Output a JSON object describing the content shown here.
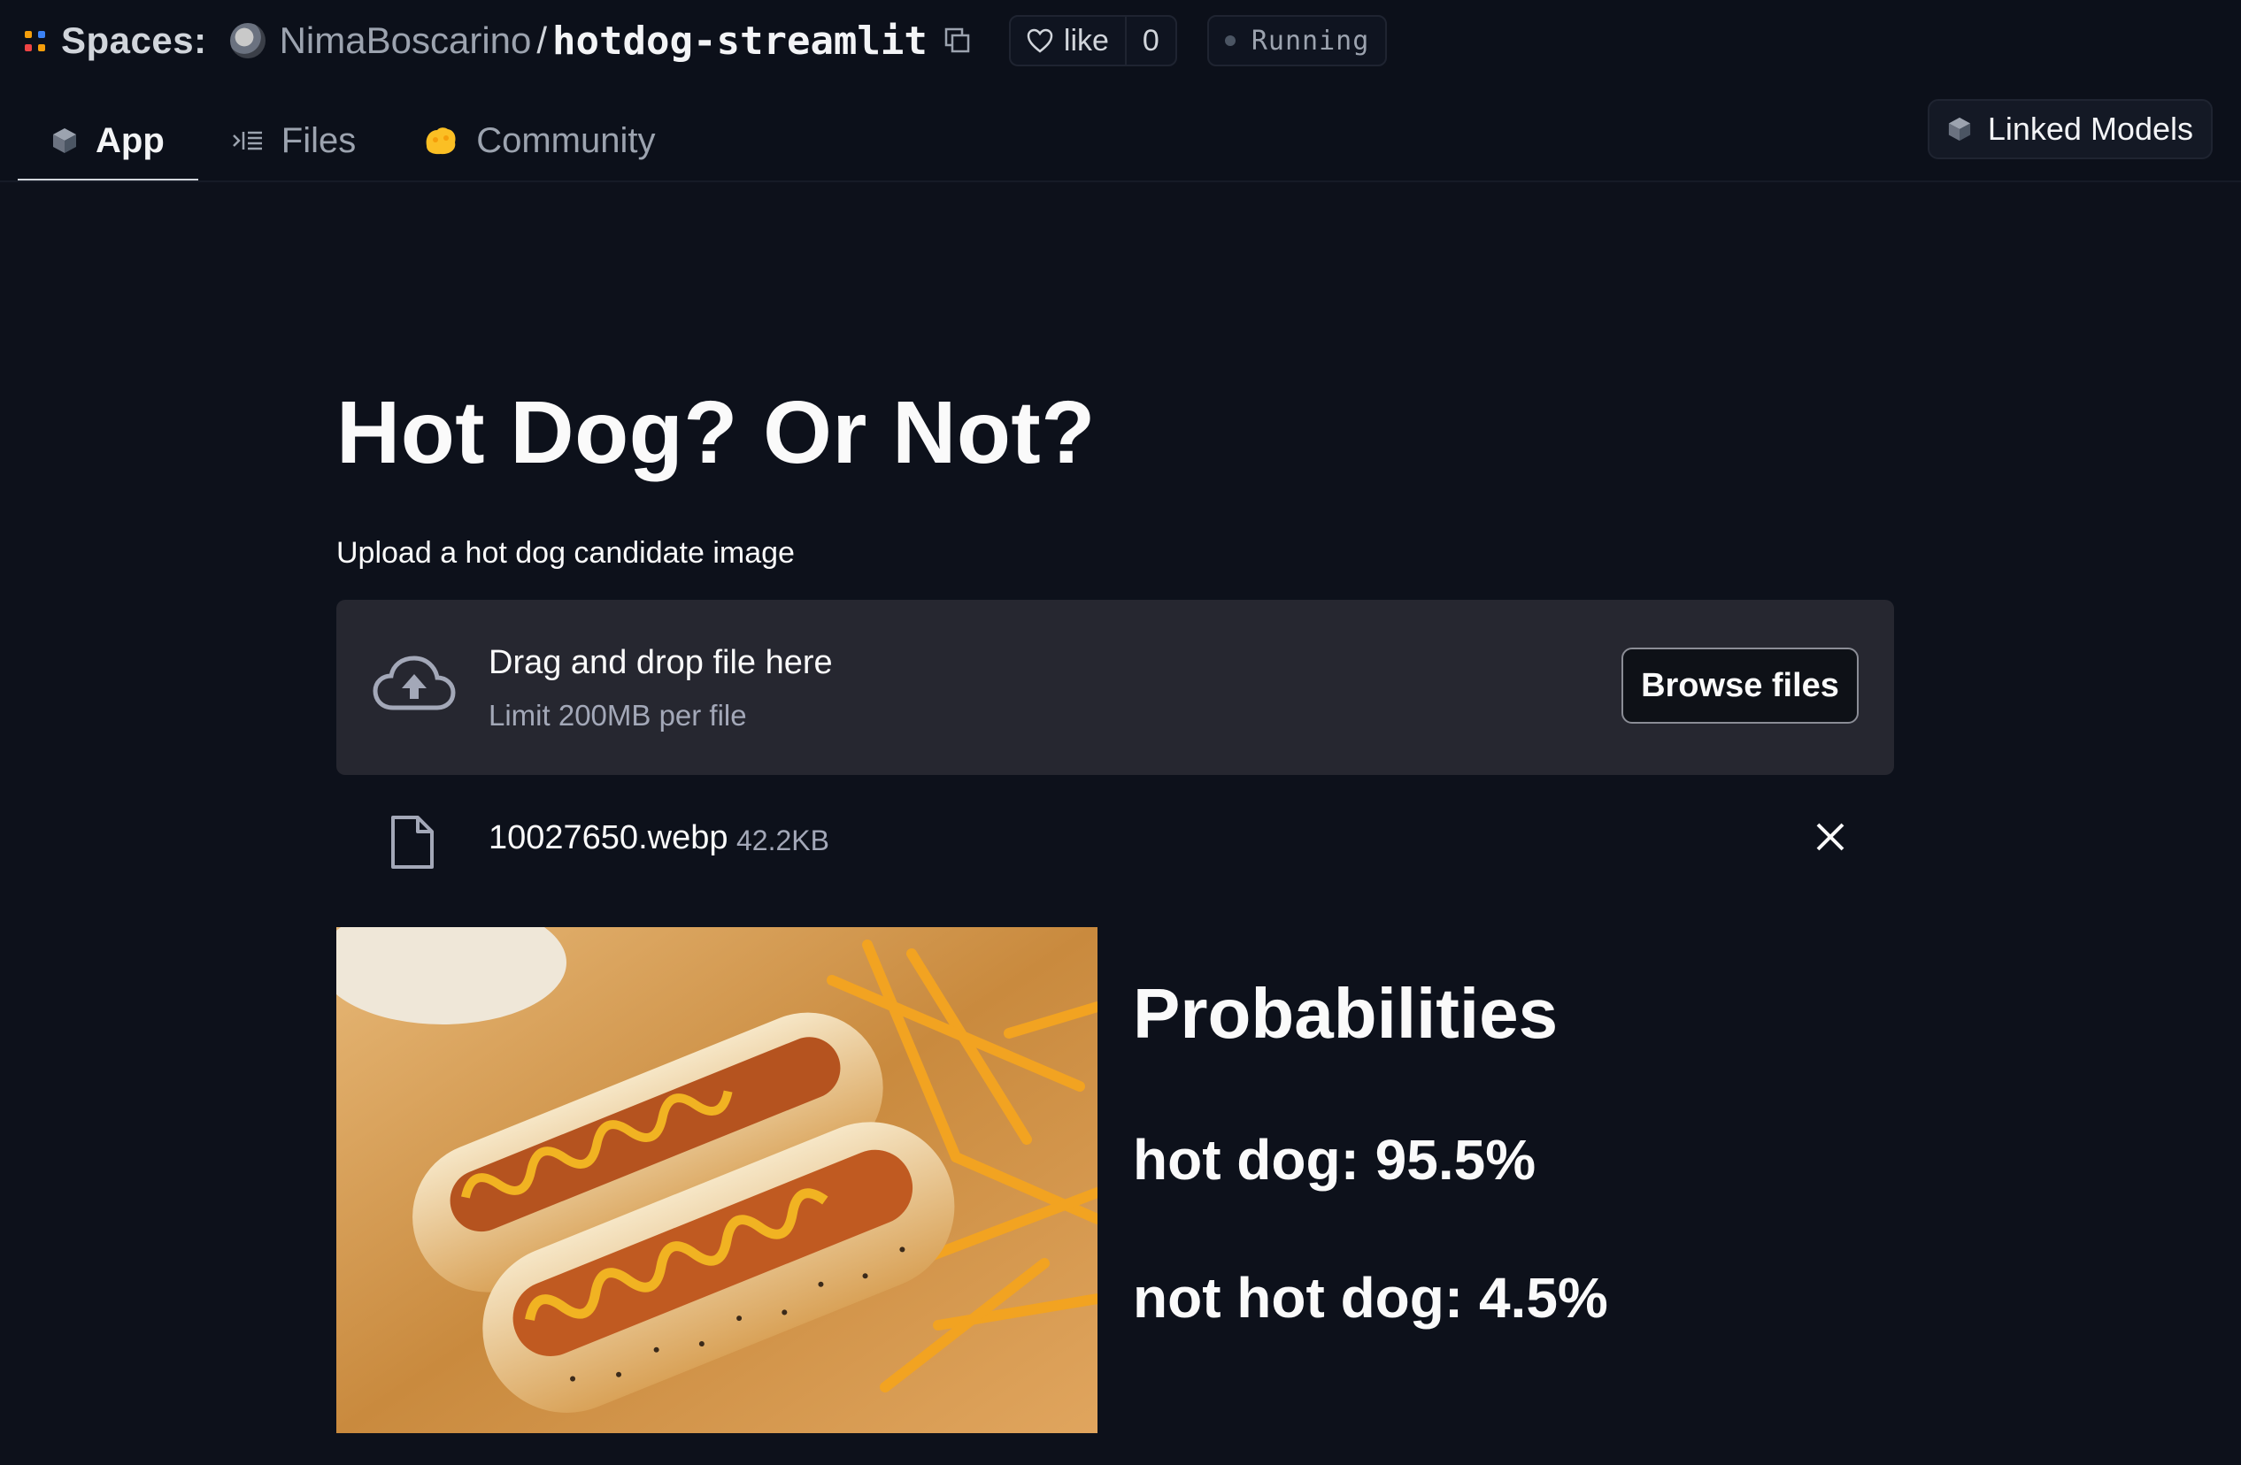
{
  "header": {
    "spaces_label": "Spaces:",
    "owner": "NimaBoscarino",
    "separator": "/",
    "repo": "hotdog-streamlit",
    "like_label": "like",
    "like_count": "0",
    "status": "Running"
  },
  "tabs": [
    {
      "label": "App",
      "icon": "cube-icon",
      "active": true
    },
    {
      "label": "Files",
      "icon": "files-icon",
      "active": false
    },
    {
      "label": "Community",
      "icon": "community-icon",
      "active": false
    }
  ],
  "linked_models_label": "Linked Models",
  "app": {
    "title": "Hot Dog? Or Not?",
    "upload_label": "Upload a hot dog candidate image",
    "drop_text": "Drag and drop file here",
    "drop_limit": "Limit 200MB per file",
    "browse_label": "Browse files",
    "file_name": "10027650.webp",
    "file_size": "42.2KB",
    "probabilities_title": "Probabilities",
    "hot_dog_result": "hot dog: 95.5%",
    "not_hot_dog_result": "not hot dog: 4.5%"
  },
  "colors": {
    "background": "#0d111b",
    "dropzone": "#262730",
    "text": "#fafafa",
    "muted": "#a3a8b8",
    "spaces_dots": [
      "#f59e0b",
      "#3b82f6",
      "#ef4444",
      "#f59e0b"
    ]
  }
}
